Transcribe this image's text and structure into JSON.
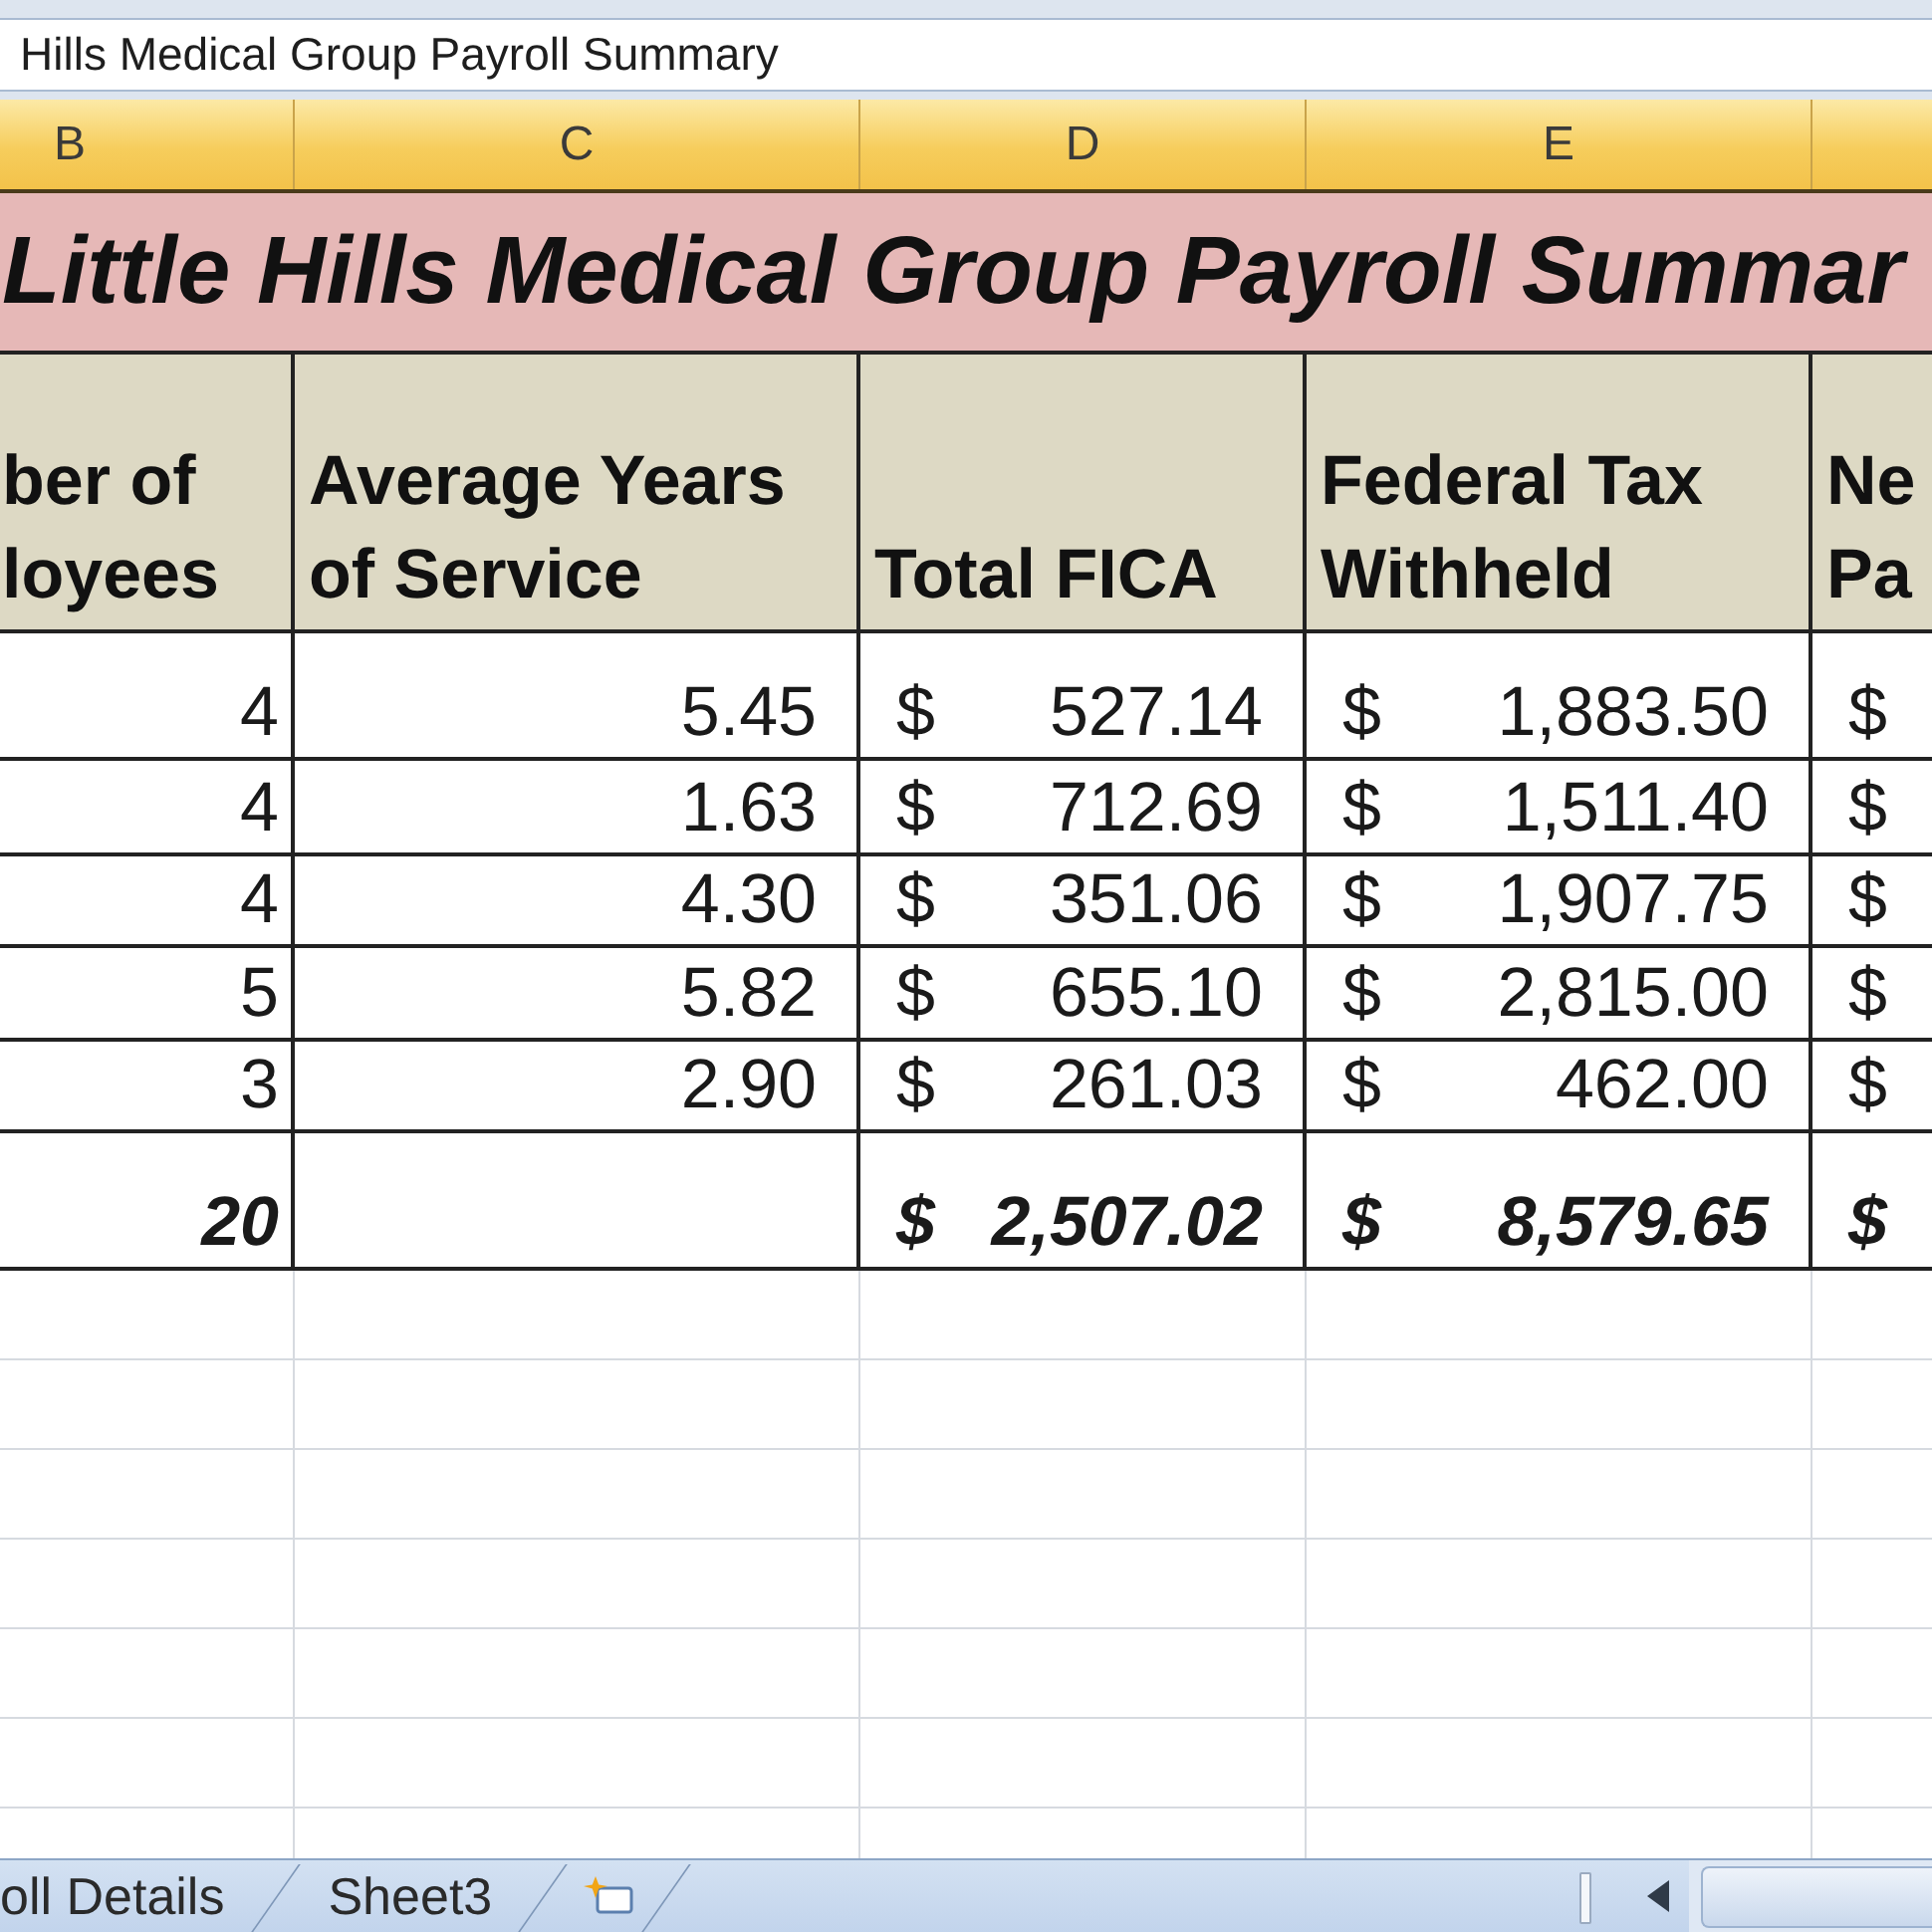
{
  "formula_bar": {
    "value": "Hills Medical Group Payroll Summary"
  },
  "column_headers": [
    "B",
    "C",
    "D",
    "E"
  ],
  "sheet_title": "Little Hills Medical Group Payroll Summar",
  "table": {
    "headings": [
      {
        "lines": [
          "ber of",
          "loyees"
        ]
      },
      {
        "lines": [
          "Average Years",
          "of Service"
        ]
      },
      {
        "lines": [
          "Total FICA"
        ]
      },
      {
        "lines": [
          "Federal Tax",
          "Withheld"
        ]
      },
      {
        "lines": [
          "Ne",
          "Pa"
        ]
      }
    ],
    "rows": [
      {
        "kind": "data",
        "employees": "4",
        "avg_years": "5.45",
        "total_fica": {
          "symbol": "$",
          "amount": "527.14"
        },
        "federal_tax": {
          "symbol": "$",
          "amount": "1,883.50"
        },
        "net_pay": {
          "symbol": "$"
        }
      },
      {
        "kind": "data",
        "employees": "4",
        "avg_years": "1.63",
        "total_fica": {
          "symbol": "$",
          "amount": "712.69"
        },
        "federal_tax": {
          "symbol": "$",
          "amount": "1,511.40"
        },
        "net_pay": {
          "symbol": "$"
        }
      },
      {
        "kind": "data",
        "employees": "4",
        "avg_years": "4.30",
        "total_fica": {
          "symbol": "$",
          "amount": "351.06"
        },
        "federal_tax": {
          "symbol": "$",
          "amount": "1,907.75"
        },
        "net_pay": {
          "symbol": "$"
        }
      },
      {
        "kind": "data",
        "employees": "5",
        "avg_years": "5.82",
        "total_fica": {
          "symbol": "$",
          "amount": "655.10"
        },
        "federal_tax": {
          "symbol": "$",
          "amount": "2,815.00"
        },
        "net_pay": {
          "symbol": "$"
        }
      },
      {
        "kind": "data",
        "employees": "3",
        "avg_years": "2.90",
        "total_fica": {
          "symbol": "$",
          "amount": "261.03"
        },
        "federal_tax": {
          "symbol": "$",
          "amount": "462.00"
        },
        "net_pay": {
          "symbol": "$"
        }
      },
      {
        "kind": "total",
        "employees": "20",
        "total_fica": {
          "symbol": "$",
          "amount": "2,507.02"
        },
        "federal_tax": {
          "symbol": "$",
          "amount": "8,579.65"
        },
        "net_pay": {
          "symbol": "$"
        }
      }
    ]
  },
  "sheet_tabs": [
    {
      "label": "oll Details",
      "selected": false
    },
    {
      "label": "Sheet3",
      "selected": false
    }
  ]
}
